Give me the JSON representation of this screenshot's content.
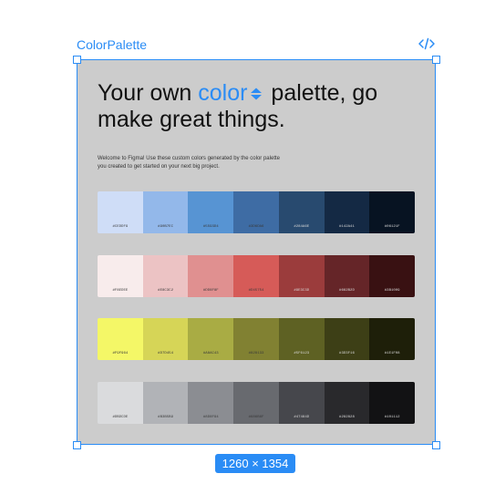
{
  "frame": {
    "label": "ColorPalette",
    "code_icon": "code-icon"
  },
  "headline": {
    "pre": "Your own ",
    "accent": "color",
    "post": " palette, go make great things."
  },
  "intro": "Welcome to Figma! Use these custom colors generated by the color palette you created to get started on your next big project.",
  "palettes": [
    {
      "name": "blue",
      "swatches": [
        {
          "hex": "#CEDDF9",
          "color": "#cfddf7"
        },
        {
          "hex": "#90B7EC",
          "color": "#93b8ea"
        },
        {
          "hex": "#5593D4",
          "color": "#5794d3"
        },
        {
          "hex": "#3D6DA6",
          "color": "#3e6ca4"
        },
        {
          "hex": "#284A6E",
          "color": "#284a6f"
        },
        {
          "hex": "#142A41",
          "color": "#142944"
        },
        {
          "hex": "#06121F",
          "color": "#071322"
        }
      ]
    },
    {
      "name": "red",
      "swatches": [
        {
          "hex": "#F8EDEE",
          "color": "#f8ecec"
        },
        {
          "hex": "#E8C3C2",
          "color": "#ecc3c4"
        },
        {
          "hex": "#DD8F8F",
          "color": "#e09090"
        },
        {
          "hex": "#D45754",
          "color": "#d65b58"
        },
        {
          "hex": "#9E3C3D",
          "color": "#9b3c3c"
        },
        {
          "hex": "#662B2D",
          "color": "#652528"
        },
        {
          "hex": "#3B1009",
          "color": "#391112"
        }
      ]
    },
    {
      "name": "yellow",
      "swatches": [
        {
          "hex": "#F9F964",
          "color": "#f4f767"
        },
        {
          "hex": "#D7D454",
          "color": "#d6d557"
        },
        {
          "hex": "#A8AC43",
          "color": "#a9ac44"
        },
        {
          "hex": "#828133",
          "color": "#818132"
        },
        {
          "hex": "#5F6123",
          "color": "#5e6123"
        },
        {
          "hex": "#3D3F16",
          "color": "#3d3f16"
        },
        {
          "hex": "#1E1F08",
          "color": "#1e1f09"
        }
      ]
    },
    {
      "name": "gray",
      "swatches": [
        {
          "hex": "#DBDCDE",
          "color": "#dadbdd"
        },
        {
          "hex": "#B3B5B9",
          "color": "#b1b3b7"
        },
        {
          "hex": "#8D8F94",
          "color": "#8b8d92"
        },
        {
          "hex": "#686B6F",
          "color": "#686a6f"
        },
        {
          "hex": "#47484D",
          "color": "#46474c"
        },
        {
          "hex": "#282828",
          "color": "#29292c"
        },
        {
          "hex": "#101112",
          "color": "#121214"
        }
      ]
    }
  ],
  "size_badge": "1260 × 1354",
  "colors": {
    "selection": "#2a8cf5",
    "frame_bg": "#cccccc"
  }
}
